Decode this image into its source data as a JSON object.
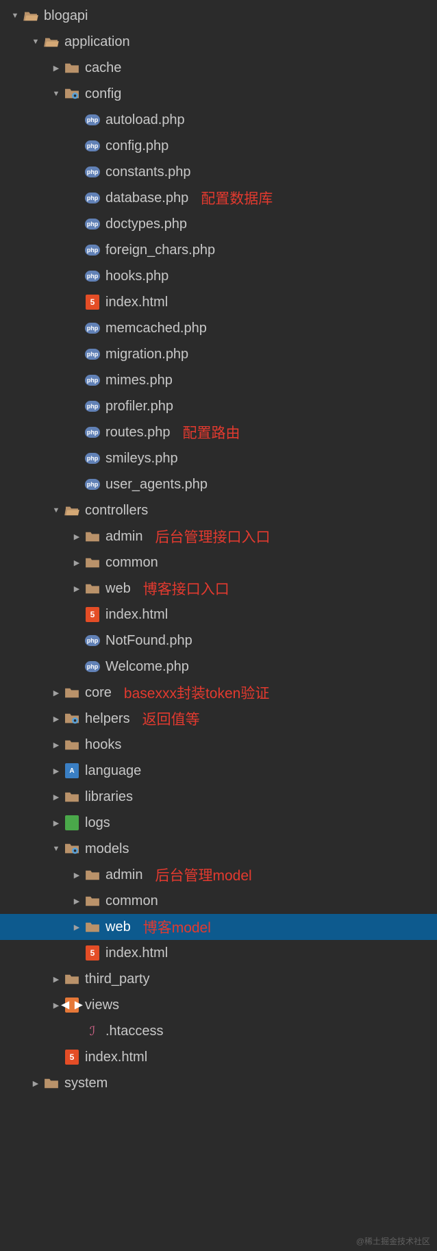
{
  "tree": [
    {
      "depth": 0,
      "arrow": "down",
      "icon": "folder-open",
      "label": "blogapi"
    },
    {
      "depth": 1,
      "arrow": "down",
      "icon": "folder-open",
      "label": "application"
    },
    {
      "depth": 2,
      "arrow": "right",
      "icon": "folder-closed",
      "label": "cache"
    },
    {
      "depth": 2,
      "arrow": "down",
      "icon": "gear",
      "label": "config"
    },
    {
      "depth": 3,
      "arrow": "",
      "icon": "php",
      "label": "autoload.php"
    },
    {
      "depth": 3,
      "arrow": "",
      "icon": "php",
      "label": "config.php"
    },
    {
      "depth": 3,
      "arrow": "",
      "icon": "php",
      "label": "constants.php"
    },
    {
      "depth": 3,
      "arrow": "",
      "icon": "php",
      "label": "database.php",
      "annot": "配置数据库"
    },
    {
      "depth": 3,
      "arrow": "",
      "icon": "php",
      "label": "doctypes.php"
    },
    {
      "depth": 3,
      "arrow": "",
      "icon": "php",
      "label": "foreign_chars.php"
    },
    {
      "depth": 3,
      "arrow": "",
      "icon": "php",
      "label": "hooks.php"
    },
    {
      "depth": 3,
      "arrow": "",
      "icon": "html",
      "label": "index.html"
    },
    {
      "depth": 3,
      "arrow": "",
      "icon": "php",
      "label": "memcached.php"
    },
    {
      "depth": 3,
      "arrow": "",
      "icon": "php",
      "label": "migration.php"
    },
    {
      "depth": 3,
      "arrow": "",
      "icon": "php",
      "label": "mimes.php"
    },
    {
      "depth": 3,
      "arrow": "",
      "icon": "php",
      "label": "profiler.php"
    },
    {
      "depth": 3,
      "arrow": "",
      "icon": "php",
      "label": "routes.php",
      "annot": "配置路由"
    },
    {
      "depth": 3,
      "arrow": "",
      "icon": "php",
      "label": "smileys.php"
    },
    {
      "depth": 3,
      "arrow": "",
      "icon": "php",
      "label": "user_agents.php"
    },
    {
      "depth": 2,
      "arrow": "down",
      "icon": "folder-open",
      "label": "controllers"
    },
    {
      "depth": 3,
      "arrow": "right",
      "icon": "folder-closed",
      "label": "admin",
      "annot": "后台管理接口入口"
    },
    {
      "depth": 3,
      "arrow": "right",
      "icon": "folder-closed",
      "label": "common"
    },
    {
      "depth": 3,
      "arrow": "right",
      "icon": "folder-closed",
      "label": "web",
      "annot": "博客接口入口"
    },
    {
      "depth": 3,
      "arrow": "",
      "icon": "html",
      "label": "index.html"
    },
    {
      "depth": 3,
      "arrow": "",
      "icon": "php",
      "label": "NotFound.php"
    },
    {
      "depth": 3,
      "arrow": "",
      "icon": "php",
      "label": "Welcome.php"
    },
    {
      "depth": 2,
      "arrow": "right",
      "icon": "folder-closed",
      "label": "core",
      "annot": "basexxx封装token验证"
    },
    {
      "depth": 2,
      "arrow": "right",
      "icon": "gear",
      "label": "helpers",
      "annot": "返回值等"
    },
    {
      "depth": 2,
      "arrow": "right",
      "icon": "folder-closed",
      "label": "hooks"
    },
    {
      "depth": 2,
      "arrow": "right",
      "icon": "lang",
      "label": "language"
    },
    {
      "depth": 2,
      "arrow": "right",
      "icon": "folder-closed",
      "label": "libraries"
    },
    {
      "depth": 2,
      "arrow": "right",
      "icon": "log",
      "label": "logs"
    },
    {
      "depth": 2,
      "arrow": "down",
      "icon": "gear",
      "label": "models"
    },
    {
      "depth": 3,
      "arrow": "right",
      "icon": "folder-closed",
      "label": "admin",
      "annot": "后台管理model"
    },
    {
      "depth": 3,
      "arrow": "right",
      "icon": "folder-closed",
      "label": "common"
    },
    {
      "depth": 3,
      "arrow": "right",
      "icon": "folder-closed",
      "label": "web",
      "annot": "博客model",
      "selected": true
    },
    {
      "depth": 3,
      "arrow": "",
      "icon": "html",
      "label": "index.html"
    },
    {
      "depth": 2,
      "arrow": "right",
      "icon": "folder-closed",
      "label": "third_party"
    },
    {
      "depth": 2,
      "arrow": "right",
      "icon": "view",
      "label": "views"
    },
    {
      "depth": 3,
      "arrow": "",
      "icon": "feather",
      "label": ".htaccess"
    },
    {
      "depth": 2,
      "arrow": "",
      "icon": "html",
      "label": "index.html"
    },
    {
      "depth": 1,
      "arrow": "right",
      "icon": "folder-closed",
      "label": "system"
    }
  ],
  "watermark": "@稀土掘金技术社区",
  "indent_base": 14,
  "indent_step": 30
}
